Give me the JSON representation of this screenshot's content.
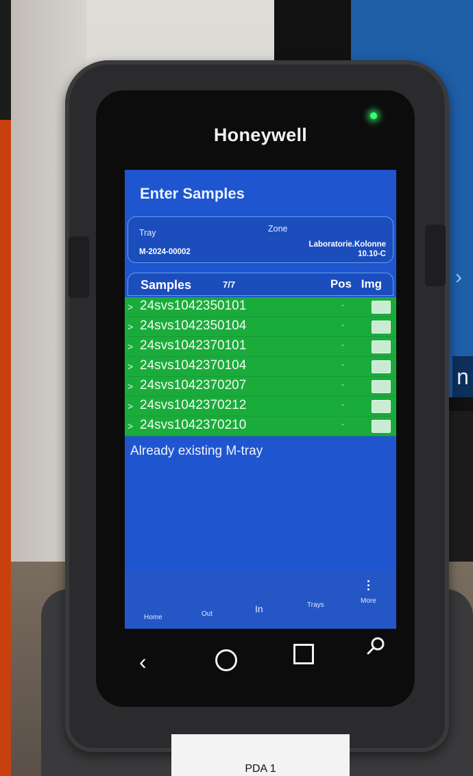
{
  "device": {
    "brand": "Honeywell",
    "label": "PDA 1"
  },
  "screen": {
    "title": "Enter Samples",
    "tray_label": "Tray",
    "tray_value": "M-2024-00002",
    "zone_label": "Zone",
    "zone_value_line1": "Laboratorie.Kolonne",
    "zone_value_line2": "10.10-C",
    "samples_label": "Samples",
    "samples_count": "7/7",
    "pos_header": "Pos",
    "img_header": "Img",
    "rows": [
      {
        "id": "24svs1042350101",
        "pos": "-"
      },
      {
        "id": "24svs1042350104",
        "pos": "-"
      },
      {
        "id": "24svs1042370101",
        "pos": "-"
      },
      {
        "id": "24svs1042370104",
        "pos": "-"
      },
      {
        "id": "24svs1042370207",
        "pos": "-"
      },
      {
        "id": "24svs1042370212",
        "pos": "-"
      },
      {
        "id": "24svs1042370210",
        "pos": "-"
      }
    ],
    "row_arrow": ">",
    "message": "Already existing M-tray"
  },
  "nav": {
    "home": "Home",
    "out": "Out",
    "in": "In",
    "trays": "Trays",
    "more": "More"
  },
  "colors": {
    "screen_bg": "#1f55cf",
    "row_green": "#1aac3a"
  },
  "background": {
    "monitor_glyph": "n"
  }
}
